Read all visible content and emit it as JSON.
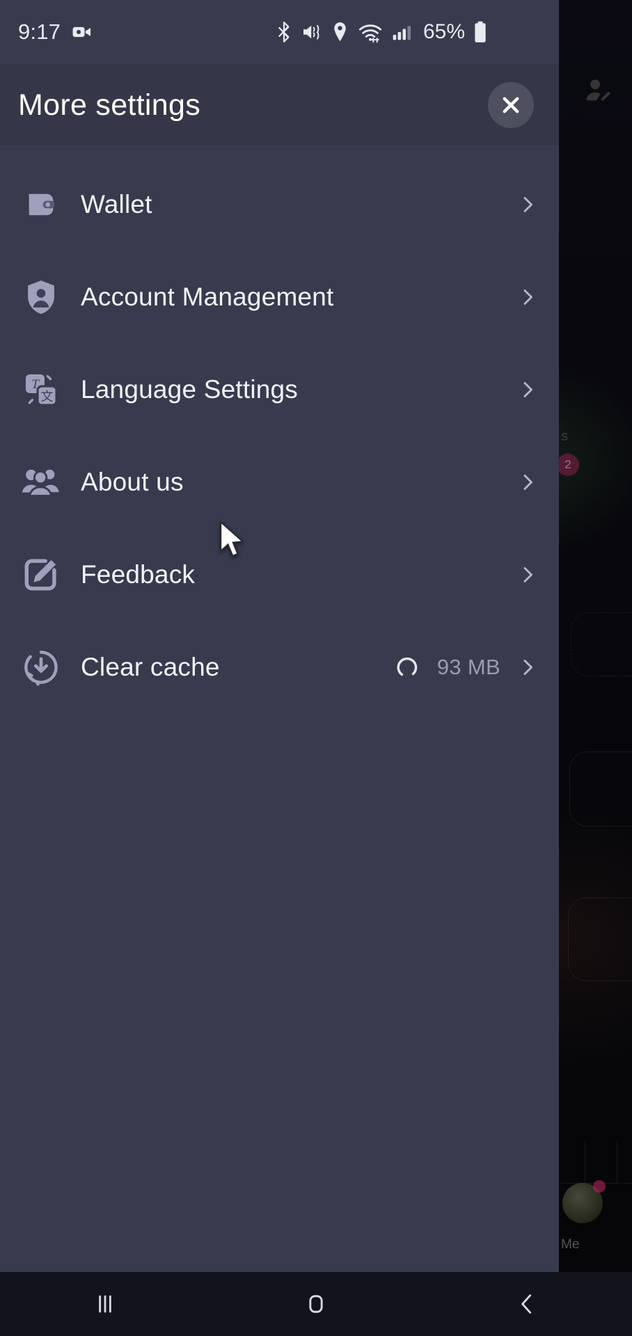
{
  "status_bar": {
    "time": "9:17",
    "battery_percent": "65%",
    "icons": [
      "video-recording-icon",
      "bluetooth-icon",
      "mute-vibrate-icon",
      "location-icon",
      "wifi-icon",
      "cellular-signal-icon",
      "battery-icon"
    ]
  },
  "drawer": {
    "title": "More settings",
    "close_label": "✕",
    "items": [
      {
        "label": "Wallet",
        "icon": "wallet-icon",
        "value": "",
        "chevron": "›",
        "spinner": false
      },
      {
        "label": "Account Management",
        "icon": "shield-user-icon",
        "value": "",
        "chevron": "›",
        "spinner": false
      },
      {
        "label": "Language Settings",
        "icon": "translate-icon",
        "value": "",
        "chevron": "›",
        "spinner": false
      },
      {
        "label": "About us",
        "icon": "people-group-icon",
        "value": "",
        "chevron": "›",
        "spinner": false
      },
      {
        "label": "Feedback",
        "icon": "edit-square-icon",
        "value": "",
        "chevron": "›",
        "spinner": false
      },
      {
        "label": "Clear cache",
        "icon": "download-clear-icon",
        "value": "93 MB",
        "chevron": "›",
        "spinner": true
      }
    ]
  },
  "background_app": {
    "add_contact_icon": "add-contact-icon",
    "badge_count": "2",
    "me_tab_label": "Me",
    "partial_tab_text": "s"
  },
  "nav_bar": {
    "buttons": [
      {
        "name": "recents-button",
        "icon": "recents-icon"
      },
      {
        "name": "home-button",
        "icon": "home-icon"
      },
      {
        "name": "back-button",
        "icon": "back-chevron-icon"
      }
    ]
  },
  "colors": {
    "panel_bg": "#383a4e",
    "header_bg": "#353748",
    "icon_tint": "#9fa0bb",
    "label": "#f3f3fa",
    "muted": "#9b9cab",
    "nav_bg": "#12131c",
    "badge": "#8e1f4e"
  }
}
